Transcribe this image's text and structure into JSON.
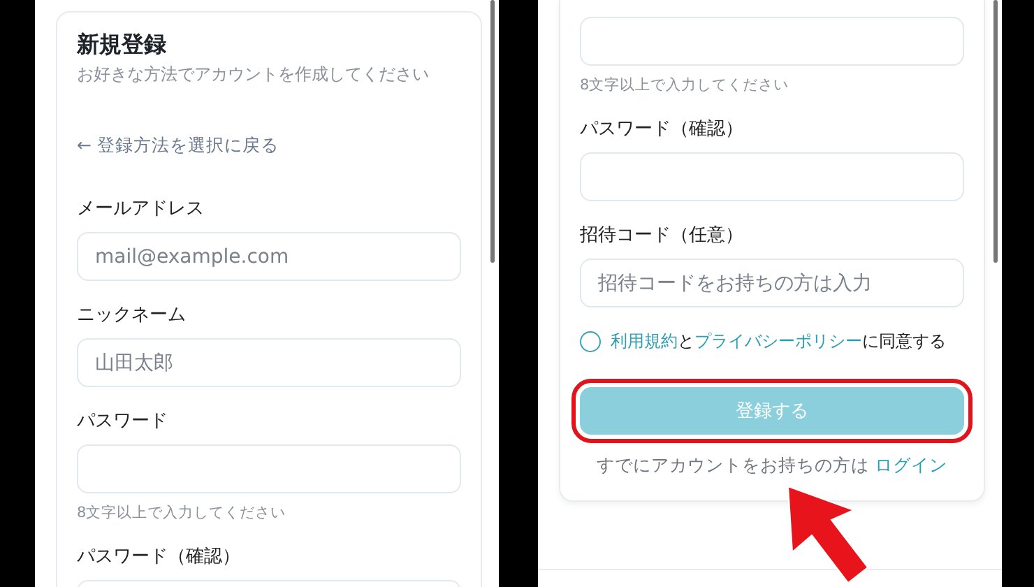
{
  "screens": [
    {
      "title": "新規登録",
      "subtitle": "お好きな方法でアカウントを作成してください",
      "back_link": "← 登録方法を選択に戻る",
      "fields": [
        {
          "label": "メールアドレス",
          "placeholder": "mail@example.com"
        },
        {
          "label": "ニックネーム",
          "placeholder": "山田太郎"
        },
        {
          "label": "パスワード",
          "hint": "8文字以上で入力してください"
        },
        {
          "label": "パスワード（確認）"
        }
      ]
    },
    {
      "fields": [
        {
          "hint": "8文字以上で入力してください"
        },
        {
          "label": "パスワード（確認）"
        },
        {
          "label": "招待コード（任意）",
          "placeholder": "招待コードをお持ちの方は入力"
        }
      ],
      "agreement": {
        "checked": false,
        "parts": [
          {
            "kind": "link",
            "text": "利用規約"
          },
          {
            "kind": "text",
            "text": "と"
          },
          {
            "kind": "link",
            "text": "プライバシーポリシー"
          },
          {
            "kind": "text",
            "text": "に同意する"
          }
        ]
      },
      "submit": {
        "label": "登録する",
        "highlighted": true
      },
      "login_prompt": {
        "text": "すでにアカウントをお持ちの方は",
        "link": "ログイン"
      }
    }
  ]
}
